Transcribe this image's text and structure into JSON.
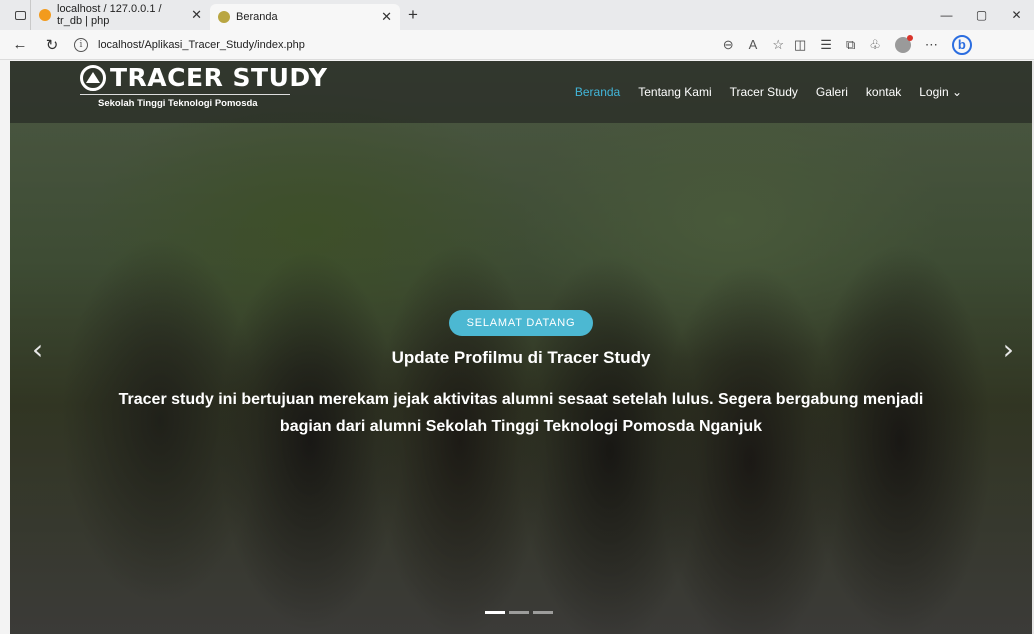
{
  "browser": {
    "tabs": [
      {
        "title": "localhost / 127.0.0.1 / tr_db | php",
        "favicon_color": "#f29b1d"
      },
      {
        "title": "Beranda",
        "favicon_color": "#b9a642"
      }
    ],
    "new_tab": "+",
    "url": "localhost/Aplikasi_Tracer_Study/index.php",
    "controls": {
      "minimize": "—",
      "restore": "▢",
      "close": "✕"
    }
  },
  "site": {
    "logo_title": "TRACER STUDY",
    "logo_subtitle": "Sekolah Tinggi Teknologi Pomosda",
    "menu": [
      {
        "label": "Beranda",
        "active": true
      },
      {
        "label": "Tentang Kami",
        "active": false
      },
      {
        "label": "Tracer Study",
        "active": false
      },
      {
        "label": "Galeri",
        "active": false
      },
      {
        "label": "kontak",
        "active": false
      },
      {
        "label": "Login ⌄",
        "active": false
      }
    ]
  },
  "hero": {
    "badge": "SELAMAT DATANG",
    "heading": "Update Profilmu di Tracer Study",
    "text": "Tracer study ini bertujuan merekam jejak aktivitas alumni sesaat setelah lulus. Segera bergabung menjadi bagian dari alumni Sekolah Tinggi Teknologi Pomosda Nganjuk",
    "prev": "‹",
    "next": "›",
    "slides": 3,
    "active_slide": 1
  },
  "colors": {
    "accent": "#42b5d8",
    "badge": "#4cb8d2"
  }
}
